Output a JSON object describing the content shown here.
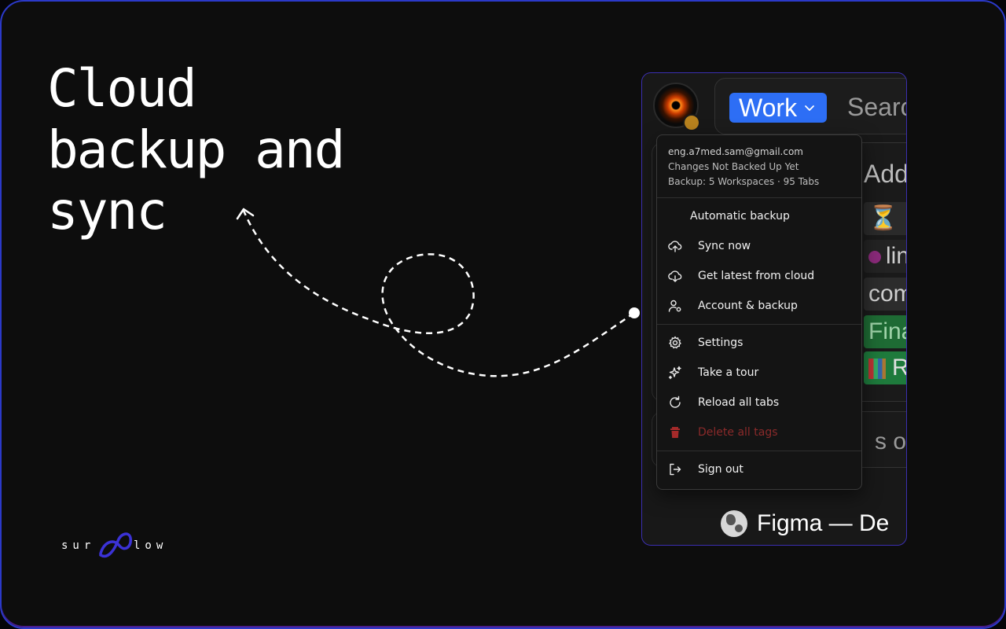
{
  "headline": "Cloud\nbackup and\nsync",
  "brand": {
    "left_text": "sur",
    "right_text": "low"
  },
  "app": {
    "workspace_label": "Work",
    "search_placeholder": "Search",
    "bg_add_text": "Add a",
    "bg_rows": [
      "⏳",
      "lin",
      "com",
      "Finan",
      "R"
    ],
    "bg_input_text": "s or v",
    "bottom_tab": "Figma — De"
  },
  "menu": {
    "email": "eng.a7med.sam@gmail.com",
    "status": "Changes Not Backed Up Yet",
    "backup_info": "Backup: 5 Workspaces · 95 Tabs",
    "automatic_backup": "Automatic backup",
    "sync_now": "Sync now",
    "get_latest": "Get latest from cloud",
    "account_backup": "Account & backup",
    "settings": "Settings",
    "take_tour": "Take a tour",
    "reload_tabs": "Reload all tabs",
    "delete_tags": "Delete all tags",
    "sign_out": "Sign out"
  },
  "colors": {
    "accent_blue": "#2d6ef5",
    "frame_border": "#2b39c9",
    "danger": "#8b2a2a",
    "brand_purple": "#3b32d6"
  }
}
